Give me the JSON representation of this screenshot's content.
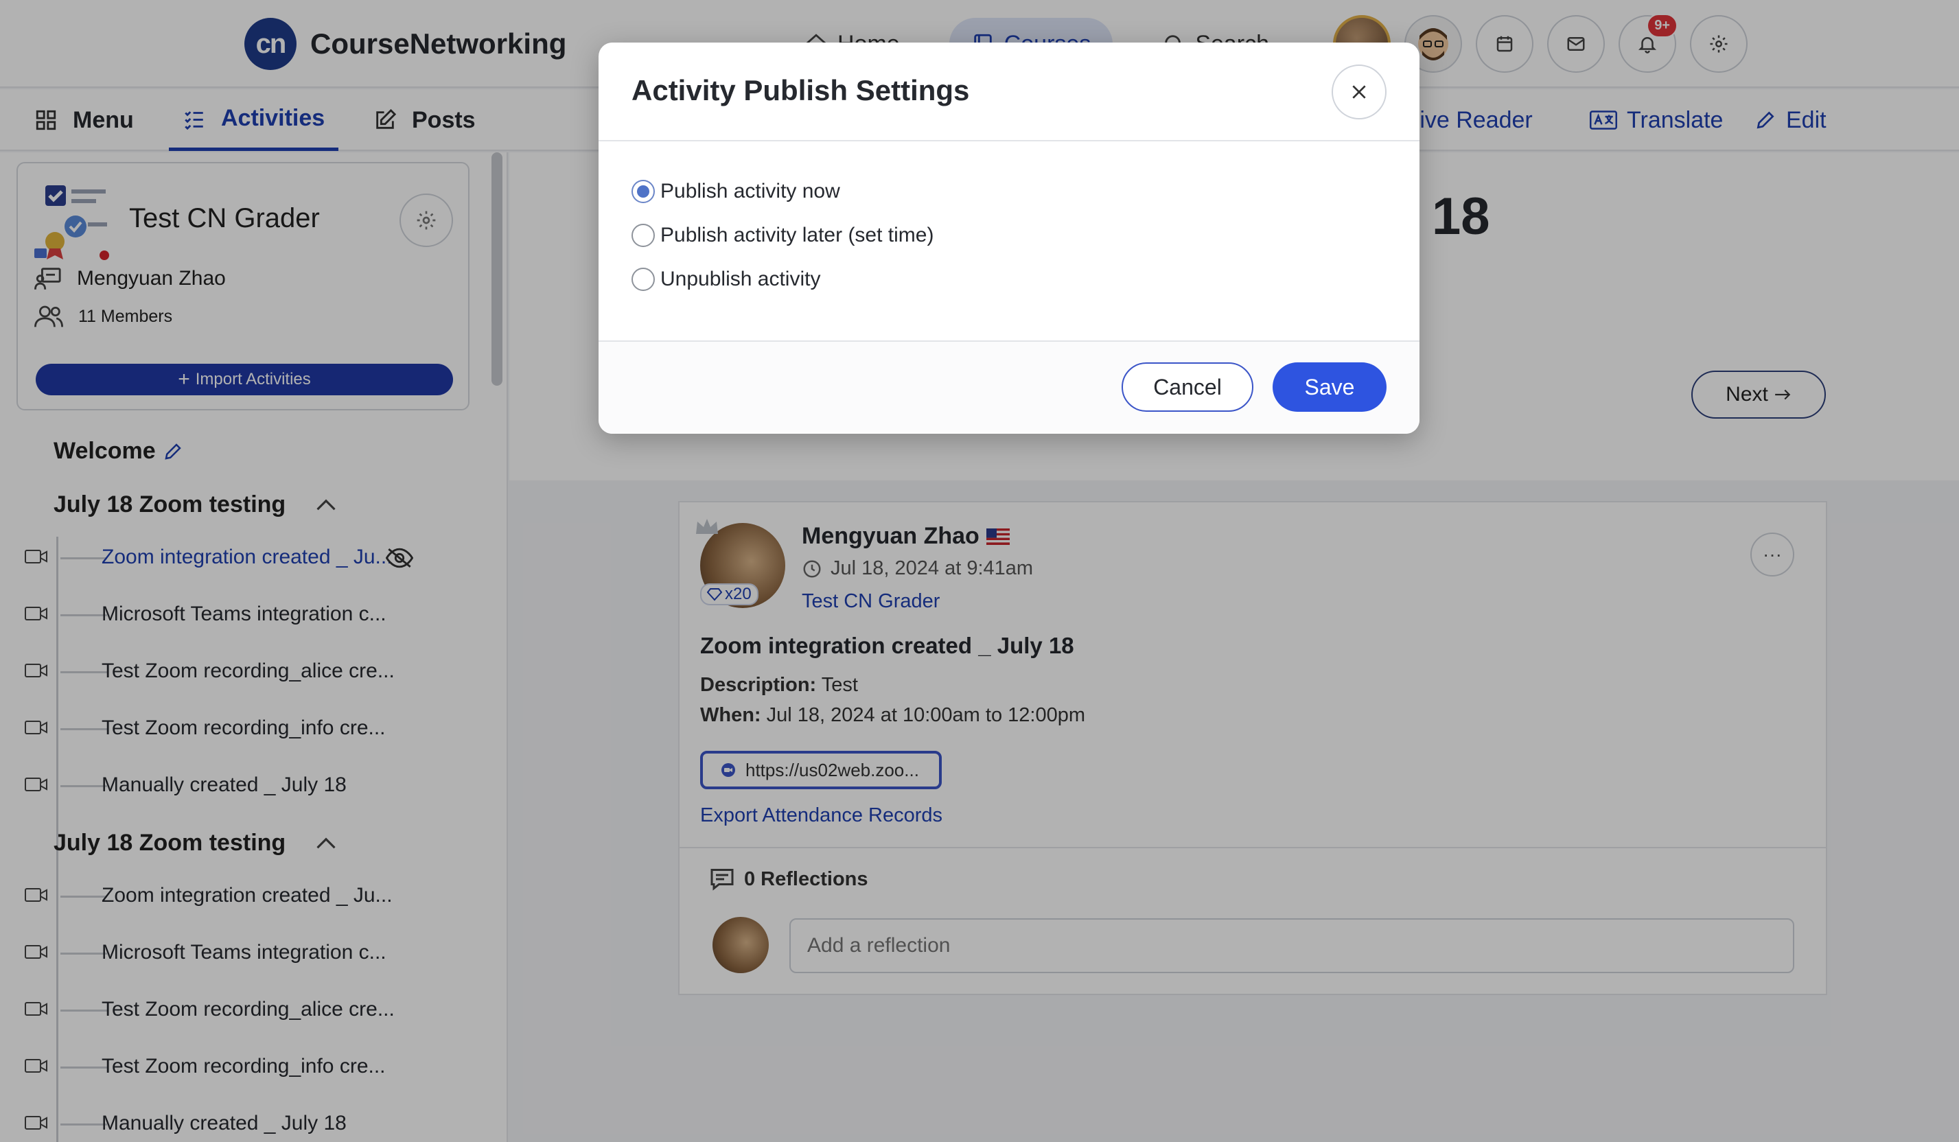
{
  "header": {
    "brand": "CourseNetworking",
    "logo_mark": "cn",
    "nav": [
      {
        "label": "Home",
        "icon": "home-icon"
      },
      {
        "label": "Courses",
        "icon": "courses-icon"
      },
      {
        "label": "Search",
        "icon": "search-icon"
      }
    ],
    "notification_badge": "9+"
  },
  "subnav": {
    "menu": "Menu",
    "activities": "Activities",
    "posts": "Posts",
    "immersive_reader": "rsive Reader",
    "translate": "Translate",
    "edit": "Edit"
  },
  "course": {
    "name": "Test CN Grader",
    "owner": "Mengyuan Zhao",
    "members": "11 Members",
    "import_label": "Import Activities"
  },
  "sidebar": {
    "welcome": "Welcome",
    "sections": [
      {
        "title": "July 18 Zoom testing",
        "items": [
          {
            "label": "Zoom integration created _ Ju..."
          },
          {
            "label": "Microsoft Teams integration c..."
          },
          {
            "label": "Test Zoom recording_alice cre..."
          },
          {
            "label": "Test Zoom recording_info cre..."
          },
          {
            "label": "Manually created _ July 18"
          }
        ]
      },
      {
        "title": "July 18 Zoom testing",
        "items": [
          {
            "label": "Zoom integration created _ Ju..."
          },
          {
            "label": "Microsoft Teams integration c..."
          },
          {
            "label": "Test Zoom recording_alice cre..."
          },
          {
            "label": "Test Zoom recording_info cre..."
          },
          {
            "label": "Manually created _ July 18"
          }
        ]
      }
    ]
  },
  "main": {
    "partial_title": "18",
    "next_label": "Next"
  },
  "post": {
    "author": "Mengyuan Zhao",
    "xp": "x20",
    "timestamp": "Jul 18, 2024 at 9:41am",
    "group": "Test CN Grader",
    "title": "Zoom integration created _ July 18",
    "desc_label": "Description:",
    "desc_value": "Test",
    "when_label": "When:",
    "when_value": "Jul 18, 2024 at 10:00am to 12:00pm",
    "link": "https://us02web.zoo...",
    "export": "Export Attendance Records",
    "reflections": "0 Reflections",
    "reflection_placeholder": "Add a reflection"
  },
  "modal": {
    "title": "Activity Publish Settings",
    "options": [
      {
        "label": "Publish activity now",
        "checked": true
      },
      {
        "label": "Publish activity later (set time)",
        "checked": false
      },
      {
        "label": "Unpublish activity",
        "checked": false
      }
    ],
    "cancel": "Cancel",
    "save": "Save"
  },
  "colors": {
    "accent": "#1f3fb0",
    "primary_button": "#2e54e0",
    "badge": "#e0343a"
  }
}
